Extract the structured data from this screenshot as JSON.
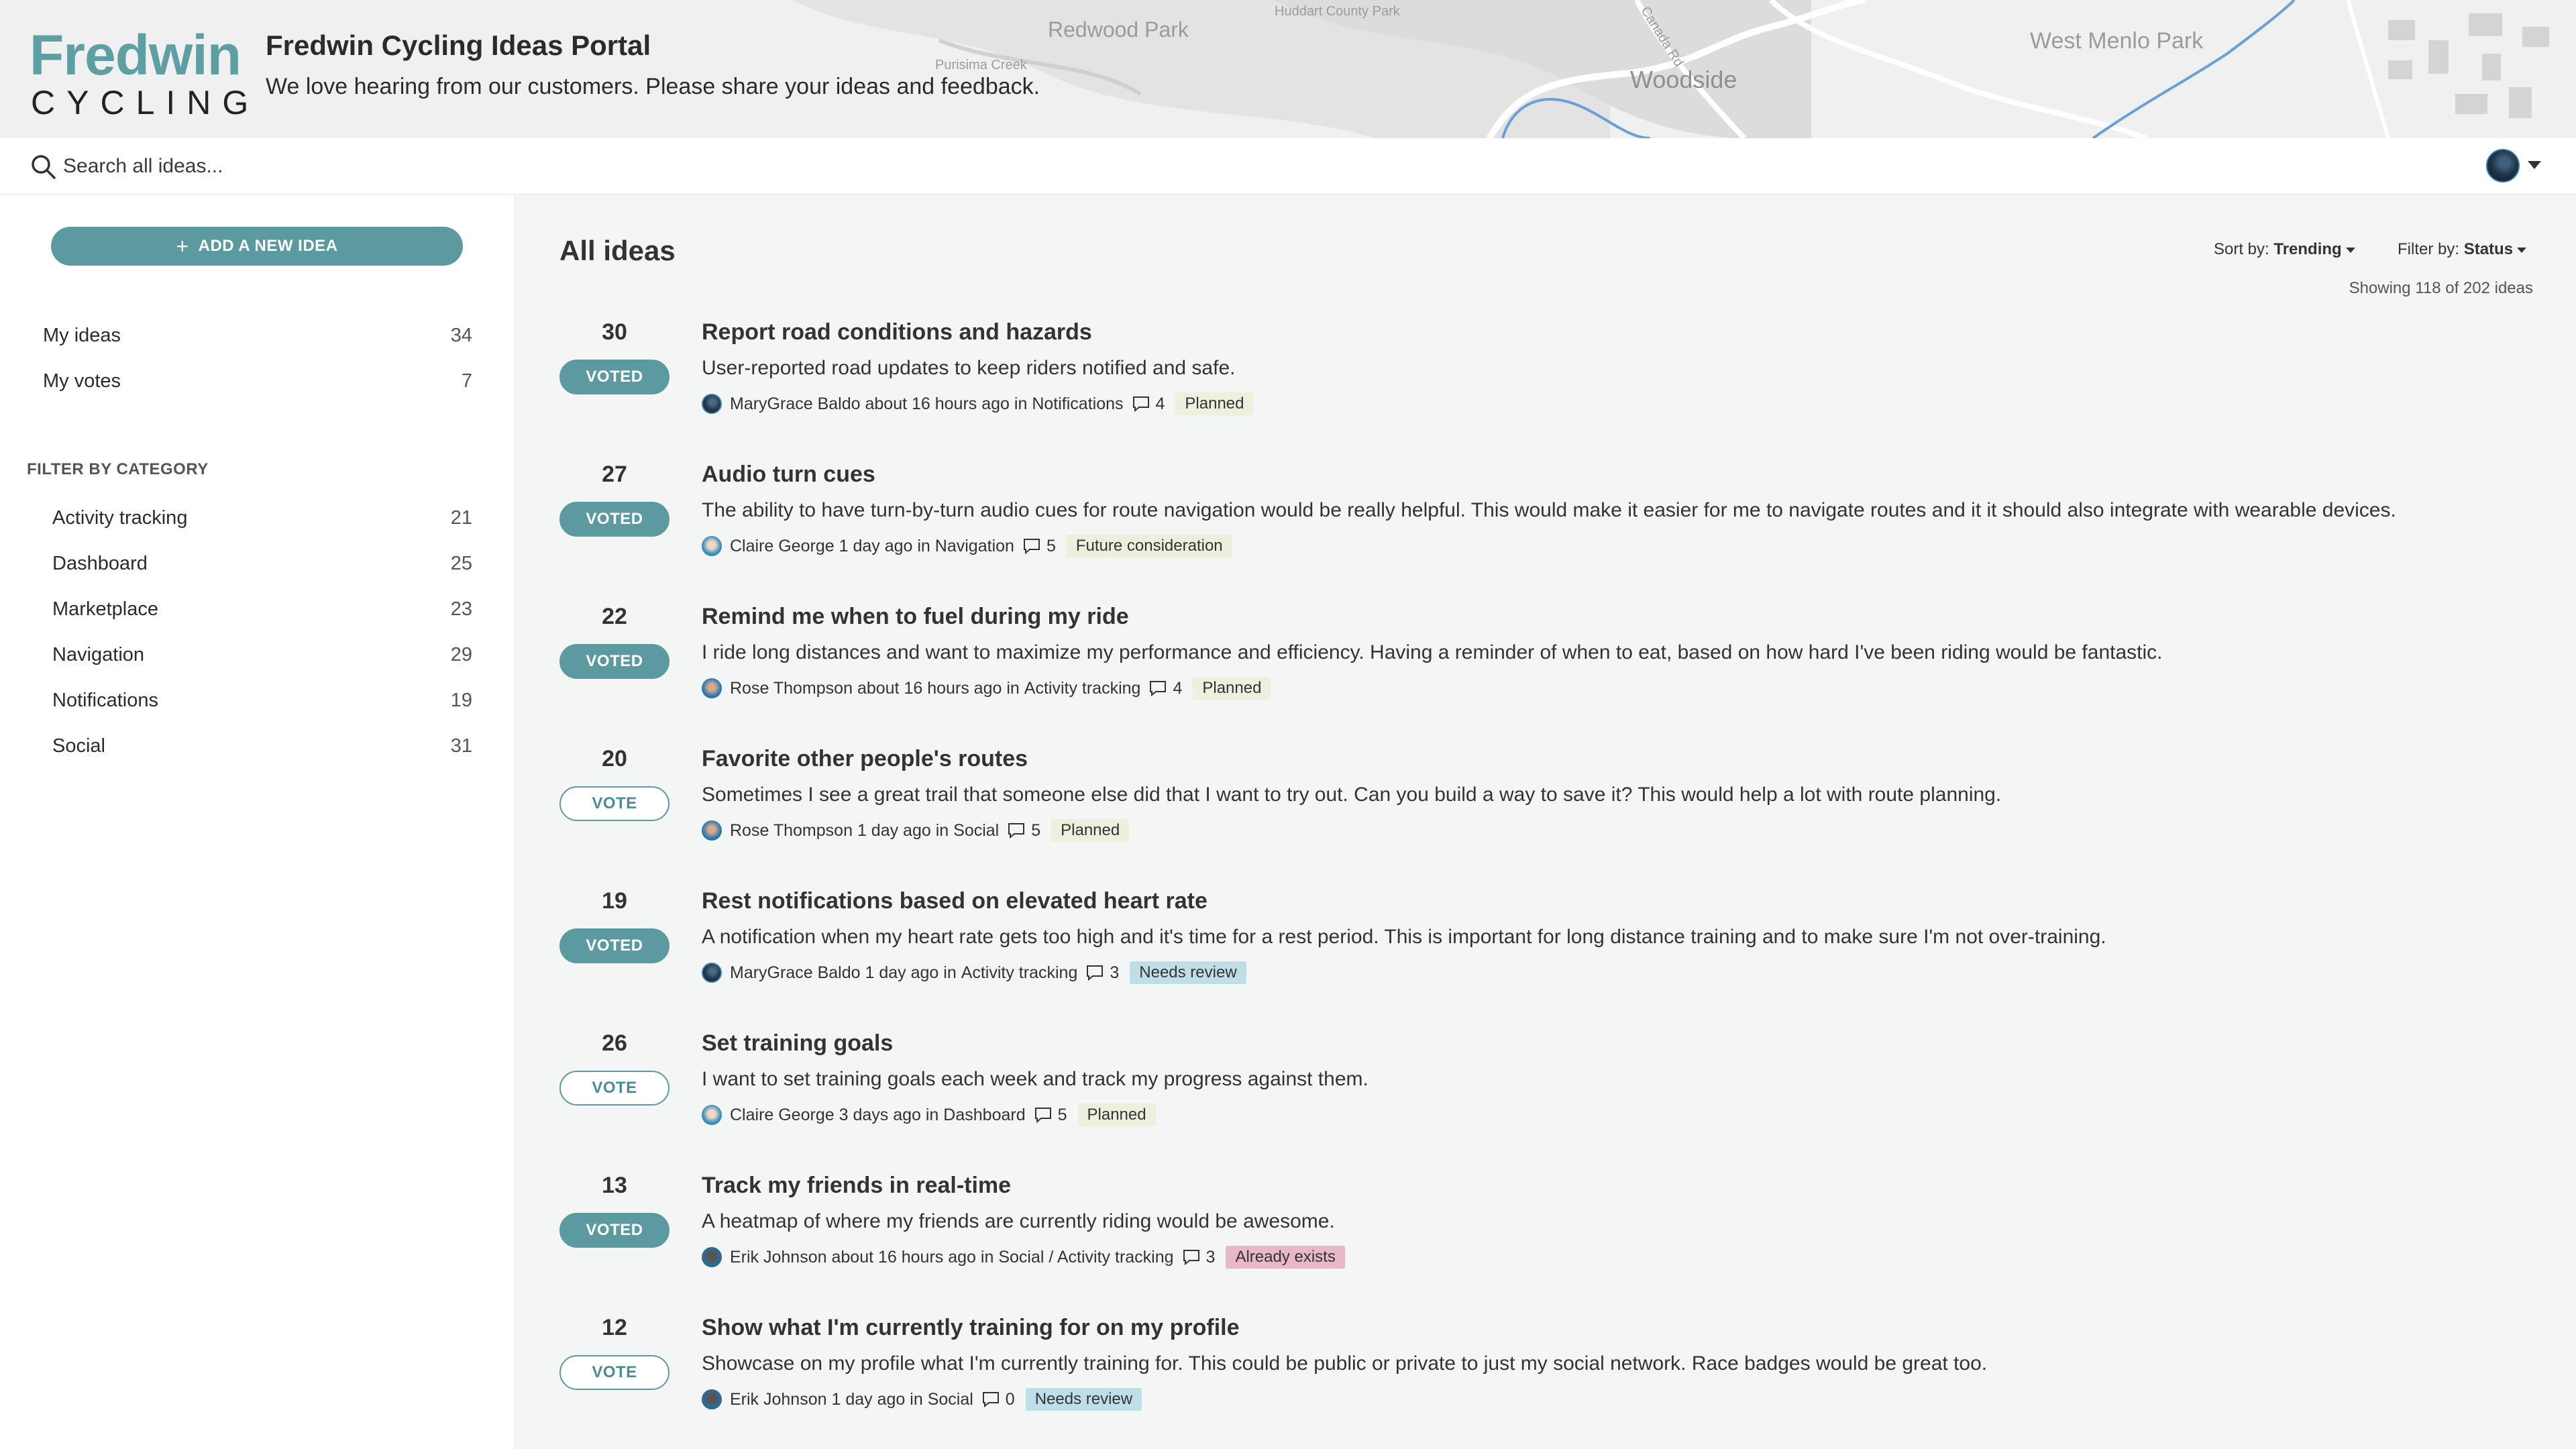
{
  "brand": {
    "logo_word": "Fredwin",
    "logo_sub": "CYCLING",
    "portal_title": "Fredwin Cycling Ideas Portal",
    "portal_subtitle": "We love hearing from our customers. Please share your ideas and feedback.",
    "accent_color": "#5b9b9f"
  },
  "map_labels": [
    "Redwood Park",
    "Huddart County Park",
    "Purisima Creek",
    "Woodside",
    "West Menlo Park",
    "Canada Rd"
  ],
  "search": {
    "placeholder": "Search all ideas..."
  },
  "sidebar": {
    "add_button": "ADD A NEW IDEA",
    "personal": [
      {
        "label": "My ideas",
        "count": "34"
      },
      {
        "label": "My votes",
        "count": "7"
      }
    ],
    "filter_heading": "FILTER BY CATEGORY",
    "categories": [
      {
        "label": "Activity tracking",
        "count": "21"
      },
      {
        "label": "Dashboard",
        "count": "25"
      },
      {
        "label": "Marketplace",
        "count": "23"
      },
      {
        "label": "Navigation",
        "count": "29"
      },
      {
        "label": "Notifications",
        "count": "19"
      },
      {
        "label": "Social",
        "count": "31"
      }
    ]
  },
  "main": {
    "title": "All ideas",
    "sort_label": "Sort by:",
    "sort_value": "Trending",
    "filter_label": "Filter by:",
    "filter_value": "Status",
    "showing": "Showing 118 of 202 ideas",
    "ideas": [
      {
        "votes": "30",
        "vote_state": "VOTED",
        "title": "Report road conditions and hazards",
        "desc": "User-reported road updates to keep riders notified and safe.",
        "author": "MaryGrace Baldo",
        "when": "about 16 hours ago",
        "in": "in",
        "category": "Notifications",
        "comments": "4",
        "status": "Planned"
      },
      {
        "votes": "27",
        "vote_state": "VOTED",
        "title": "Audio turn cues",
        "desc": "The ability to have turn-by-turn audio cues for route navigation would be really helpful. This would make it easier for me to navigate routes and it it should also integrate with wearable devices.",
        "author": "Claire George",
        "when": "1 day ago",
        "in": "in",
        "category": "Navigation",
        "comments": "5",
        "status": "Future consideration"
      },
      {
        "votes": "22",
        "vote_state": "VOTED",
        "title": "Remind me when to fuel during my ride",
        "desc": "I ride long distances and want to maximize my performance and efficiency. Having a reminder of when to eat, based on how hard I've been riding would be fantastic.",
        "author": "Rose Thompson",
        "when": "about 16 hours ago",
        "in": "in",
        "category": "Activity tracking",
        "comments": "4",
        "status": "Planned"
      },
      {
        "votes": "20",
        "vote_state": "VOTE",
        "title": "Favorite other people's routes",
        "desc": "Sometimes I see a great trail that someone else did that I want to try out. Can you build a way to save it? This would help a lot with route planning.",
        "author": "Rose Thompson",
        "when": "1 day ago",
        "in": "in",
        "category": "Social",
        "comments": "5",
        "status": "Planned"
      },
      {
        "votes": "19",
        "vote_state": "VOTED",
        "title": "Rest notifications based on elevated heart rate",
        "desc": "A notification when my heart rate gets too high and it's time for a rest period. This is important for long distance training and to make sure I'm not over-training.",
        "author": "MaryGrace Baldo",
        "when": "1 day ago",
        "in": "in",
        "category": "Activity tracking",
        "comments": "3",
        "status": "Needs review"
      },
      {
        "votes": "26",
        "vote_state": "VOTE",
        "title": "Set training goals",
        "desc": "I want to set training goals each week and track my progress against them.",
        "author": "Claire George",
        "when": "3 days ago",
        "in": "in",
        "category": "Dashboard",
        "comments": "5",
        "status": "Planned"
      },
      {
        "votes": "13",
        "vote_state": "VOTED",
        "title": "Track my friends in real-time",
        "desc": "A heatmap of where my friends are currently riding would be awesome.",
        "author": "Erik Johnson",
        "when": "about 16 hours ago",
        "in": "in",
        "category": "Social / Activity tracking",
        "comments": "3",
        "status": "Already exists"
      },
      {
        "votes": "12",
        "vote_state": "VOTE",
        "title": "Show what I'm currently training for on my profile",
        "desc": "Showcase on my profile what I'm currently training for. This could be public or private to just my social network. Race badges would be great too.",
        "author": "Erik Johnson",
        "when": "1 day ago",
        "in": "in",
        "category": "Social",
        "comments": "0",
        "status": "Needs review"
      }
    ]
  }
}
